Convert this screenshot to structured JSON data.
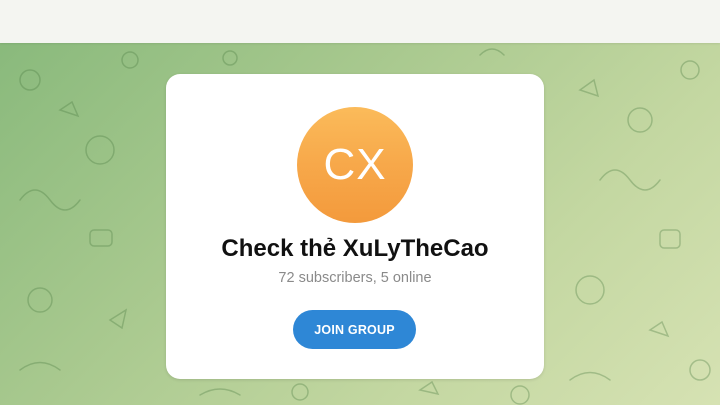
{
  "channel": {
    "avatar_initials": "CX",
    "title": "Check thẻ XuLyTheCao",
    "subtitle": "72 subscribers, 5 online",
    "join_label": "JOIN GROUP"
  },
  "colors": {
    "accent": "#2e87d6",
    "avatar": "#f7a84a",
    "background": "#a9c98f"
  }
}
